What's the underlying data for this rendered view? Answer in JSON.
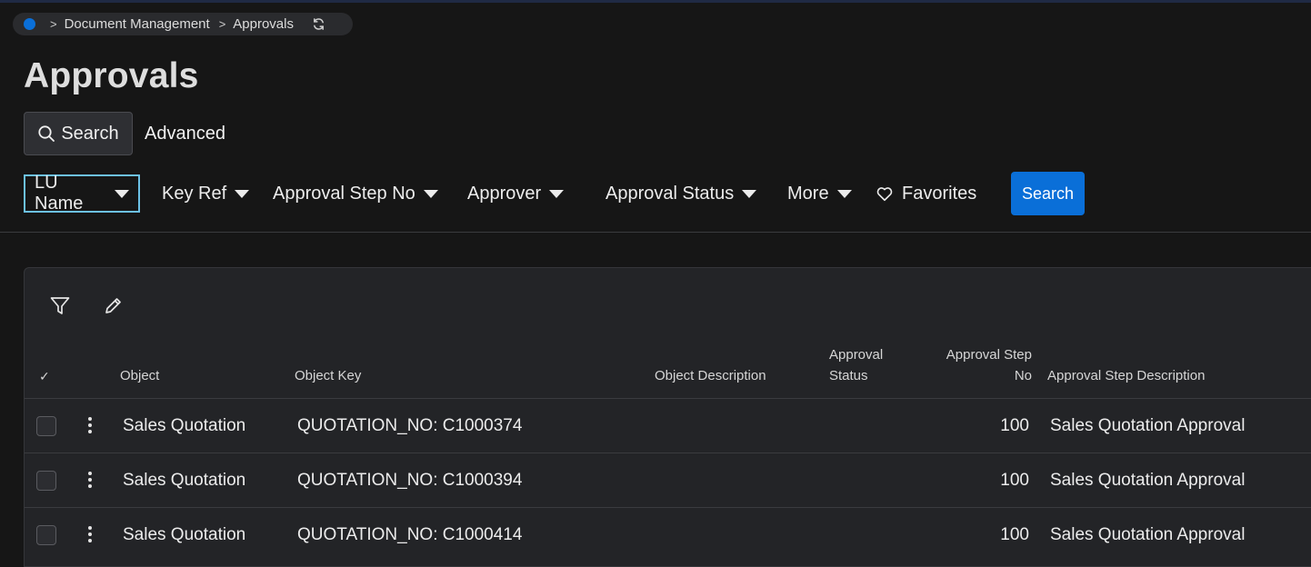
{
  "breadcrumb": {
    "items": [
      "Document Management",
      "Approvals"
    ]
  },
  "page": {
    "title": "Approvals"
  },
  "search_bar": {
    "search_mode_label": "Search",
    "advanced_label": "Advanced",
    "filters": [
      {
        "label": "LU Name",
        "focused": true
      },
      {
        "label": "Key Ref"
      },
      {
        "label": "Approval Step No"
      },
      {
        "label": "Approver"
      },
      {
        "label": "Approval Status"
      },
      {
        "label": "More"
      }
    ],
    "favorites_label": "Favorites",
    "search_button_label": "Search"
  },
  "colors": {
    "accent": "#0a6fd8",
    "focus_border": "#6cc1e6",
    "background": "#161616",
    "panel": "#232427"
  },
  "icons": {
    "toolbar": [
      "filter-icon",
      "edit-icon"
    ],
    "breadcrumb": [
      "refresh-icon"
    ],
    "search": [
      "magnifier-icon"
    ],
    "favorites": [
      "heart-icon"
    ]
  },
  "table": {
    "columns": {
      "select_all": "✓",
      "object": "Object",
      "object_key": "Object Key",
      "object_description": "Object Description",
      "approval_status_line1": "Approval",
      "approval_status_line2": "Status",
      "approval_step_no_line1": "Approval Step",
      "approval_step_no_line2": "No",
      "approval_step_description": "Approval Step Description"
    },
    "rows": [
      {
        "object": "Sales Quotation",
        "object_key": "QUOTATION_NO: C1000374",
        "object_description": "",
        "approval_status": "",
        "approval_step_no": "100",
        "approval_step_description": "Sales Quotation Approval"
      },
      {
        "object": "Sales Quotation",
        "object_key": "QUOTATION_NO: C1000394",
        "object_description": "",
        "approval_status": "",
        "approval_step_no": "100",
        "approval_step_description": "Sales Quotation Approval"
      },
      {
        "object": "Sales Quotation",
        "object_key": "QUOTATION_NO: C1000414",
        "object_description": "",
        "approval_status": "",
        "approval_step_no": "100",
        "approval_step_description": "Sales Quotation Approval"
      }
    ]
  }
}
